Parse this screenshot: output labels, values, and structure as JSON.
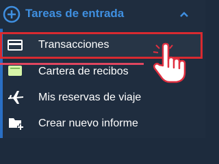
{
  "section": {
    "title": "Tareas de entrada",
    "icon": "plus-circle-icon",
    "collapse_icon": "chevron-up-icon"
  },
  "items": [
    {
      "label": "Transacciones",
      "icon": "card-icon",
      "selected": true
    },
    {
      "label": "Cartera de recibos",
      "icon": "receipt-wallet-icon",
      "selected": false
    },
    {
      "label": "Mis reservas de viaje",
      "icon": "airplane-icon",
      "selected": false
    },
    {
      "label": "Crear nuevo informe",
      "icon": "new-report-icon",
      "selected": false
    }
  ],
  "colors": {
    "background": "#1f2d3f",
    "accent": "#3f8fe0",
    "highlight": "#d92a30"
  }
}
